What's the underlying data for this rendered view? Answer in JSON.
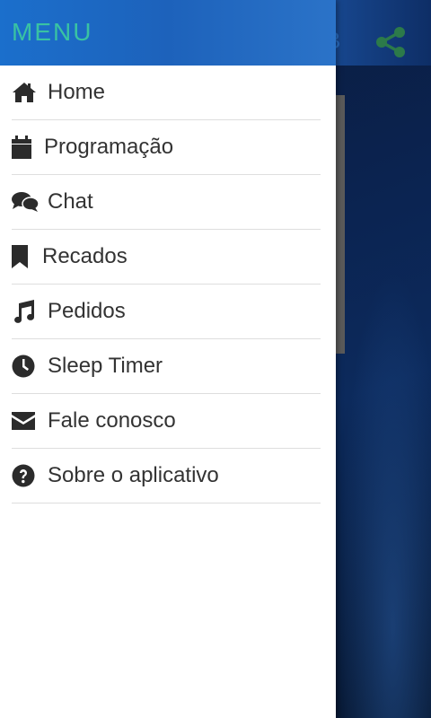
{
  "background": {
    "partial_title_glyph": "B",
    "share_icon": "share-icon"
  },
  "drawer": {
    "title": "MENU",
    "items": [
      {
        "label": "Home",
        "icon": "home-icon"
      },
      {
        "label": "Programação",
        "icon": "calendar-icon"
      },
      {
        "label": "Chat",
        "icon": "chat-icon"
      },
      {
        "label": "Recados",
        "icon": "bookmark-icon"
      },
      {
        "label": "Pedidos",
        "icon": "music-note-icon"
      },
      {
        "label": "Sleep Timer",
        "icon": "clock-icon"
      },
      {
        "label": "Fale conosco",
        "icon": "envelope-icon"
      },
      {
        "label": "Sobre o aplicativo",
        "icon": "question-circle-icon"
      }
    ]
  },
  "colors": {
    "header_blue": "#1b6fcc",
    "title_teal": "#39c2a3",
    "text": "#333333",
    "divider": "#dedede"
  }
}
